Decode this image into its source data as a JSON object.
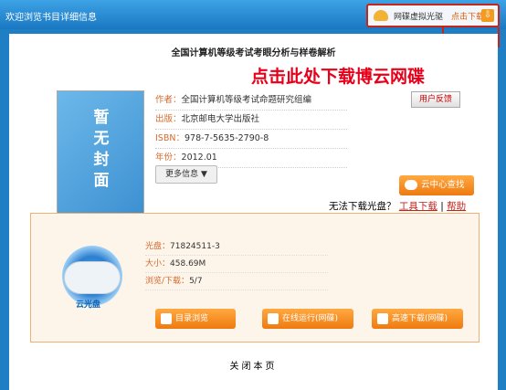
{
  "header": {
    "welcome": "欢迎浏览书目详细信息",
    "virtual_drive": "网碟虚拟光驱",
    "click_download": "点击下载",
    "download_glyph": "⇩"
  },
  "banner": {
    "title": "全国计算机等级考试考眼分析与样卷解析",
    "annotation": "点击此处下载博云网碟"
  },
  "book": {
    "cover_text_1": "暂",
    "cover_text_2": "无",
    "cover_text_3": "封",
    "cover_text_4": "面",
    "author_label": "作者",
    "author": "全国计算机等级考试命题研究组编",
    "publisher_label": "出版",
    "publisher": "北京邮电大学出版社",
    "isbn_label": "ISBN",
    "isbn": "978-7-5635-2790-8",
    "year_label": "年份",
    "year": "2012.01",
    "more_info": "更多信息 ▼"
  },
  "actions": {
    "feedback": "用户反馈",
    "cloud_search": "云中心查找",
    "cant_download": "无法下载光盘？",
    "tool_download": "工具下载",
    "separator": "|",
    "help": "帮助"
  },
  "disc": {
    "label": "云光盘",
    "disc_label": "光盘",
    "disc_value": "71824511-3",
    "size_label": "大小",
    "size_value": "458.69M",
    "views_label": "浏览/下载",
    "views_value": "5/7",
    "browse_btn": "目录浏览",
    "run_btn": "在线运行(网碟)",
    "download_btn": "高速下载(网碟)"
  },
  "footer": {
    "close": "关闭本页"
  },
  "colors": {
    "background": "#1f7fc5",
    "accent_orange": "#ee7a10",
    "highlight_red": "#e8001a"
  }
}
